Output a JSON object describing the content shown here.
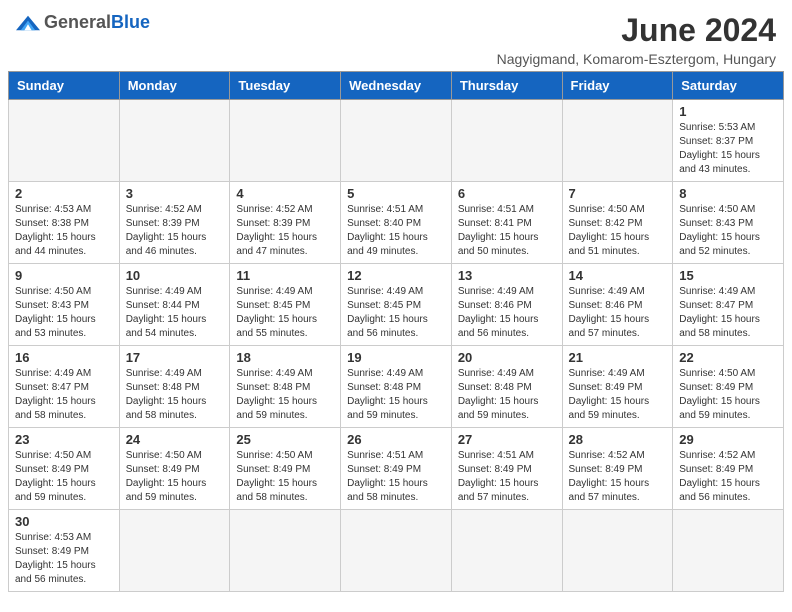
{
  "header": {
    "logo_general": "General",
    "logo_blue": "Blue",
    "month_year": "June 2024",
    "location": "Nagyigmand, Komarom-Esztergom, Hungary"
  },
  "weekdays": [
    "Sunday",
    "Monday",
    "Tuesday",
    "Wednesday",
    "Thursday",
    "Friday",
    "Saturday"
  ],
  "days": [
    {
      "date": "",
      "info": ""
    },
    {
      "date": "",
      "info": ""
    },
    {
      "date": "",
      "info": ""
    },
    {
      "date": "",
      "info": ""
    },
    {
      "date": "",
      "info": ""
    },
    {
      "date": "",
      "info": ""
    },
    {
      "date": "1",
      "sunrise": "5:53 AM",
      "sunset": "8:37 PM",
      "daylight": "15 hours and 43 minutes."
    },
    {
      "date": "2",
      "sunrise": "4:53 AM",
      "sunset": "8:38 PM",
      "daylight": "15 hours and 44 minutes."
    },
    {
      "date": "3",
      "sunrise": "4:52 AM",
      "sunset": "8:39 PM",
      "daylight": "15 hours and 46 minutes."
    },
    {
      "date": "4",
      "sunrise": "4:52 AM",
      "sunset": "8:39 PM",
      "daylight": "15 hours and 47 minutes."
    },
    {
      "date": "5",
      "sunrise": "4:51 AM",
      "sunset": "8:40 PM",
      "daylight": "15 hours and 49 minutes."
    },
    {
      "date": "6",
      "sunrise": "4:51 AM",
      "sunset": "8:41 PM",
      "daylight": "15 hours and 50 minutes."
    },
    {
      "date": "7",
      "sunrise": "4:50 AM",
      "sunset": "8:42 PM",
      "daylight": "15 hours and 51 minutes."
    },
    {
      "date": "8",
      "sunrise": "4:50 AM",
      "sunset": "8:43 PM",
      "daylight": "15 hours and 52 minutes."
    },
    {
      "date": "9",
      "sunrise": "4:50 AM",
      "sunset": "8:43 PM",
      "daylight": "15 hours and 53 minutes."
    },
    {
      "date": "10",
      "sunrise": "4:49 AM",
      "sunset": "8:44 PM",
      "daylight": "15 hours and 54 minutes."
    },
    {
      "date": "11",
      "sunrise": "4:49 AM",
      "sunset": "8:45 PM",
      "daylight": "15 hours and 55 minutes."
    },
    {
      "date": "12",
      "sunrise": "4:49 AM",
      "sunset": "8:45 PM",
      "daylight": "15 hours and 56 minutes."
    },
    {
      "date": "13",
      "sunrise": "4:49 AM",
      "sunset": "8:46 PM",
      "daylight": "15 hours and 56 minutes."
    },
    {
      "date": "14",
      "sunrise": "4:49 AM",
      "sunset": "8:46 PM",
      "daylight": "15 hours and 57 minutes."
    },
    {
      "date": "15",
      "sunrise": "4:49 AM",
      "sunset": "8:47 PM",
      "daylight": "15 hours and 58 minutes."
    },
    {
      "date": "16",
      "sunrise": "4:49 AM",
      "sunset": "8:47 PM",
      "daylight": "15 hours and 58 minutes."
    },
    {
      "date": "17",
      "sunrise": "4:49 AM",
      "sunset": "8:48 PM",
      "daylight": "15 hours and 58 minutes."
    },
    {
      "date": "18",
      "sunrise": "4:49 AM",
      "sunset": "8:48 PM",
      "daylight": "15 hours and 59 minutes."
    },
    {
      "date": "19",
      "sunrise": "4:49 AM",
      "sunset": "8:48 PM",
      "daylight": "15 hours and 59 minutes."
    },
    {
      "date": "20",
      "sunrise": "4:49 AM",
      "sunset": "8:48 PM",
      "daylight": "15 hours and 59 minutes."
    },
    {
      "date": "21",
      "sunrise": "4:49 AM",
      "sunset": "8:49 PM",
      "daylight": "15 hours and 59 minutes."
    },
    {
      "date": "22",
      "sunrise": "4:50 AM",
      "sunset": "8:49 PM",
      "daylight": "15 hours and 59 minutes."
    },
    {
      "date": "23",
      "sunrise": "4:50 AM",
      "sunset": "8:49 PM",
      "daylight": "15 hours and 59 minutes."
    },
    {
      "date": "24",
      "sunrise": "4:50 AM",
      "sunset": "8:49 PM",
      "daylight": "15 hours and 59 minutes."
    },
    {
      "date": "25",
      "sunrise": "4:50 AM",
      "sunset": "8:49 PM",
      "daylight": "15 hours and 58 minutes."
    },
    {
      "date": "26",
      "sunrise": "4:51 AM",
      "sunset": "8:49 PM",
      "daylight": "15 hours and 58 minutes."
    },
    {
      "date": "27",
      "sunrise": "4:51 AM",
      "sunset": "8:49 PM",
      "daylight": "15 hours and 57 minutes."
    },
    {
      "date": "28",
      "sunrise": "4:52 AM",
      "sunset": "8:49 PM",
      "daylight": "15 hours and 57 minutes."
    },
    {
      "date": "29",
      "sunrise": "4:52 AM",
      "sunset": "8:49 PM",
      "daylight": "15 hours and 56 minutes."
    },
    {
      "date": "30",
      "sunrise": "4:53 AM",
      "sunset": "8:49 PM",
      "daylight": "15 hours and 56 minutes."
    }
  ]
}
